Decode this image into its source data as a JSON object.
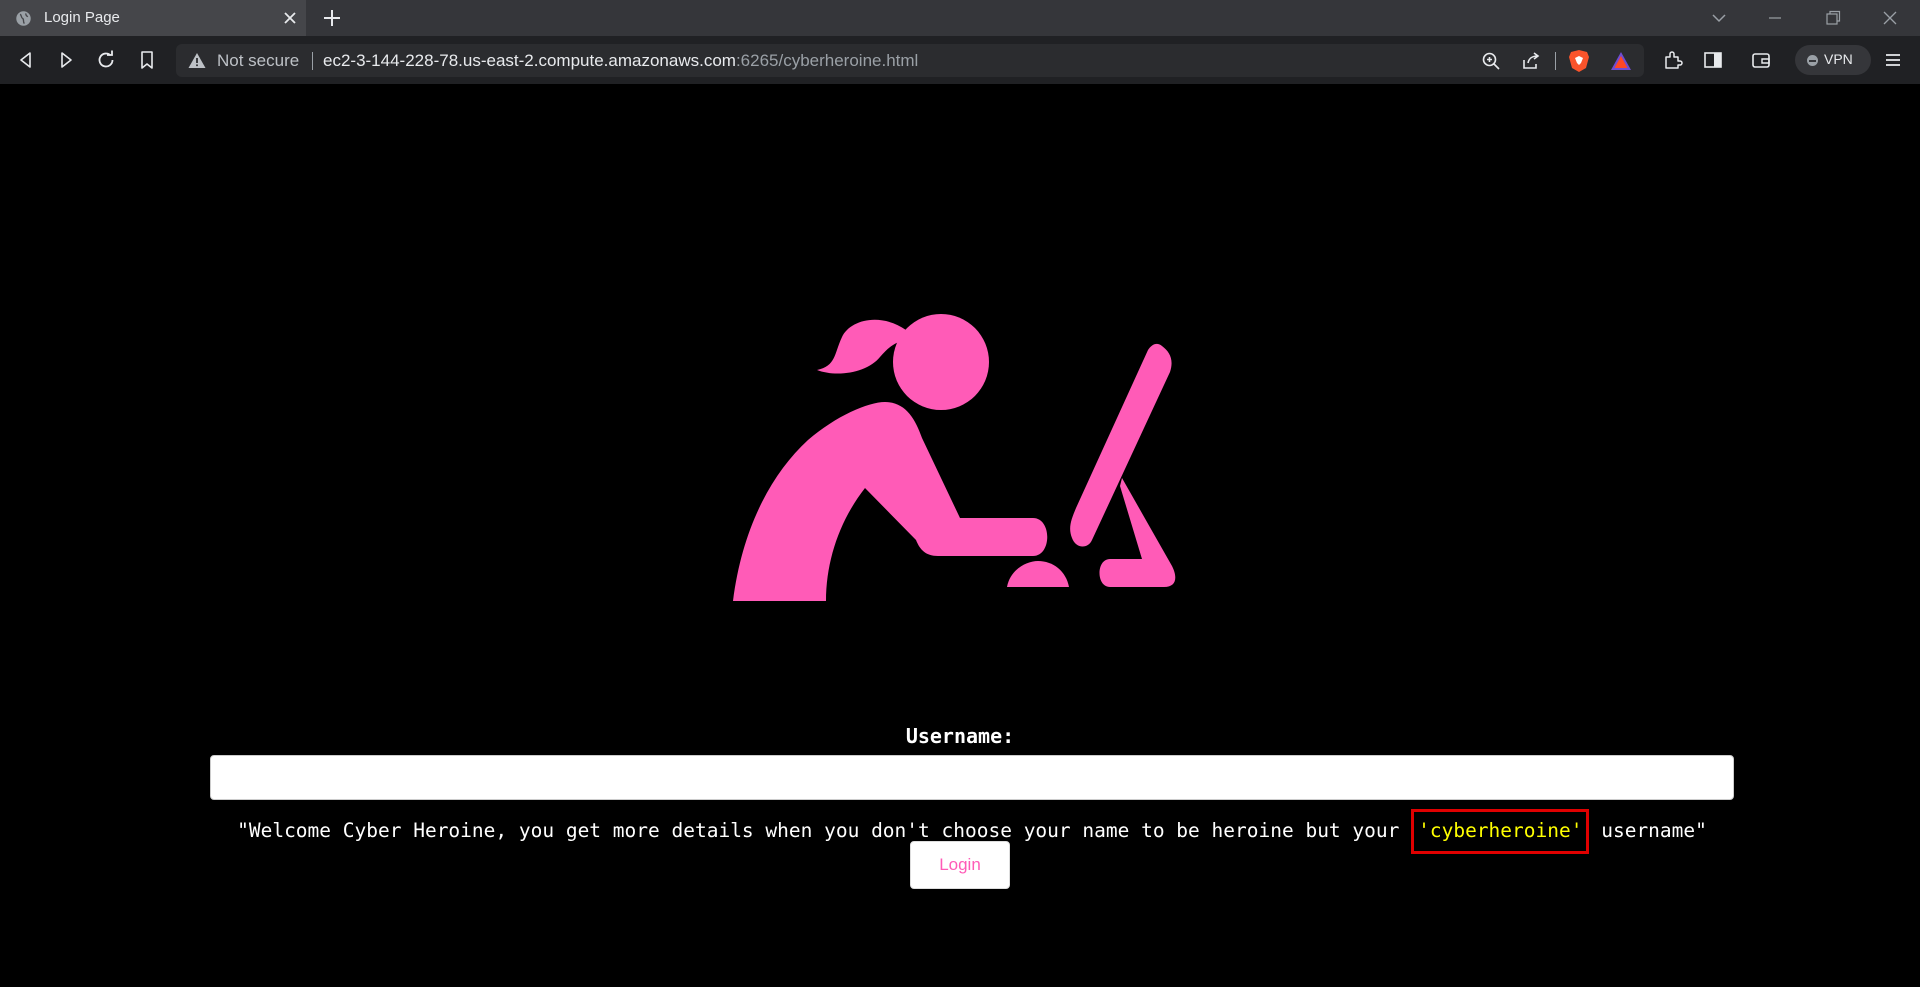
{
  "browser": {
    "tab": {
      "title": "Login Page"
    },
    "address_bar": {
      "security_label": "Not secure",
      "url_host": "ec2-3-144-228-78.us-east-2.compute.amazonaws.com",
      "url_rest": ":6265/cyberheroine.html"
    },
    "vpn_label": "VPN"
  },
  "page": {
    "illustration_icon": "woman-at-computer-icon",
    "username_label": "Username:",
    "username_value": "",
    "hint_prefix": "\"Welcome Cyber Heroine, you get more details when you don't choose your name to be heroine but your ",
    "hint_highlight": "'cyberheroine'",
    "hint_suffix": " username\"",
    "login_label": "Login"
  },
  "colors": {
    "background": "#000000",
    "accent_pink": "#ff5bb7",
    "highlight_text": "#ffff00",
    "highlight_box": "#e00000"
  }
}
